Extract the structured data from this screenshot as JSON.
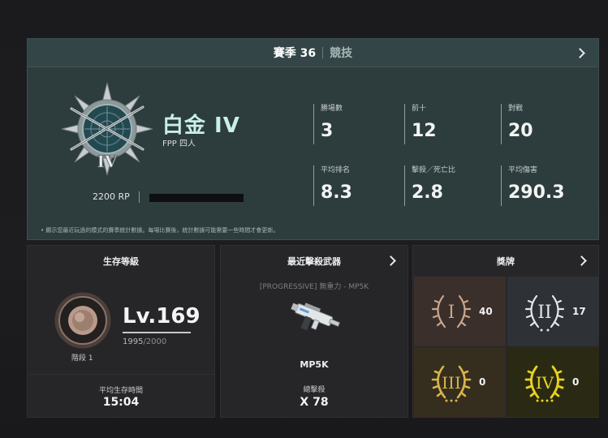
{
  "season": {
    "title": "賽季 36",
    "mode": "競技"
  },
  "rank": {
    "name": "白金 IV",
    "queue": "FPP 四人",
    "emblem_numeral": "IV",
    "rp": "2200 RP",
    "rp_progress": 0.0
  },
  "stats": [
    {
      "label": "勝場數",
      "value": "3"
    },
    {
      "label": "前十",
      "value": "12"
    },
    {
      "label": "對戰",
      "value": "20"
    },
    {
      "label": "平均排名",
      "value": "8.3"
    },
    {
      "label": "擊殺／死亡比",
      "value": "2.8"
    },
    {
      "label": "平均傷害",
      "value": "290.3"
    }
  ],
  "footnote": "• 顯示您最近玩過的模式的賽季統計數據。每場比賽後，統計數據可能需要一些時間才會更新。",
  "survival": {
    "title": "生存等級",
    "level": "Lv.169",
    "xp_current": "1995",
    "xp_max": "/2000",
    "tier": "階段 1",
    "avg_time_label": "平均生存時間",
    "avg_time": "15:04"
  },
  "weapon": {
    "title": "最近擊殺武器",
    "full_name": "[PROGRESSIVE] 無重力 - MP5K",
    "name": "MP5K",
    "kills_label": "總擊殺",
    "kills": "X 78"
  },
  "medals": {
    "title": "獎牌",
    "items": [
      {
        "numeral": "I",
        "count": "40",
        "color": "#c9a58a"
      },
      {
        "numeral": "II",
        "count": "17",
        "color": "#e4e6e8"
      },
      {
        "numeral": "III",
        "count": "0",
        "color": "#d8b44a"
      },
      {
        "numeral": "IV",
        "count": "0",
        "color": "#e8d21e"
      }
    ]
  },
  "colors": {
    "panel": "#2d3c3d",
    "rank_text": "#c9efe9",
    "card": "#262629"
  }
}
